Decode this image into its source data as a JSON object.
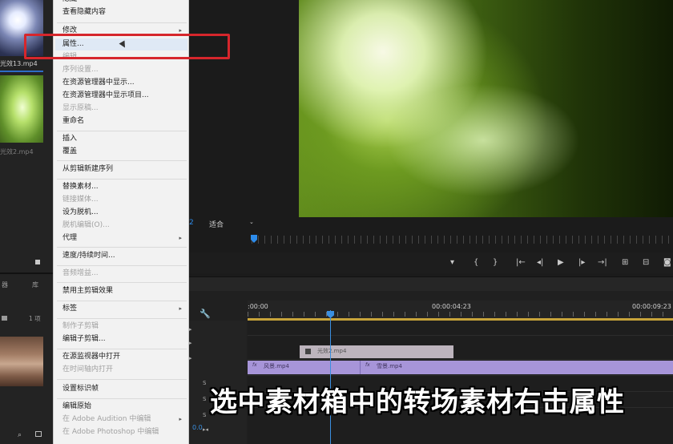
{
  "project_panel": {
    "clip_1_name": "光效13.mp4",
    "clip_2_name": "光效2.mp4",
    "tab_a": "器",
    "tab_b": "库",
    "item_count": "1 项"
  },
  "context_menu": {
    "items": [
      {
        "label": "隐藏",
        "disabled": false
      },
      {
        "label": "查看隐藏内容",
        "disabled": false
      },
      {
        "label": "修改",
        "disabled": false,
        "submenu": true
      },
      {
        "label": "属性...",
        "disabled": false,
        "highlighted": true
      },
      {
        "label": "编辑...",
        "disabled": true
      },
      {
        "label": "序列设置...",
        "disabled": true
      },
      {
        "label": "在资源管理器中显示...",
        "disabled": false
      },
      {
        "label": "在资源管理器中显示项目...",
        "disabled": false
      },
      {
        "label": "显示原稿...",
        "disabled": true
      },
      {
        "label": "重命名",
        "disabled": false
      },
      {
        "label": "插入",
        "disabled": false
      },
      {
        "label": "覆盖",
        "disabled": false
      },
      {
        "label": "从剪辑新建序列",
        "disabled": false
      },
      {
        "label": "替换素材...",
        "disabled": false
      },
      {
        "label": "链接媒体...",
        "disabled": true
      },
      {
        "label": "设为脱机...",
        "disabled": false
      },
      {
        "label": "脱机编辑(O)...",
        "disabled": true
      },
      {
        "label": "代理",
        "disabled": false,
        "submenu": true
      },
      {
        "label": "速度/持续时间...",
        "disabled": false
      },
      {
        "label": "音频增益...",
        "disabled": true
      },
      {
        "label": "禁用主剪辑效果",
        "disabled": false
      },
      {
        "label": "标签",
        "disabled": false,
        "submenu": true
      },
      {
        "label": "制作子剪辑",
        "disabled": true
      },
      {
        "label": "编辑子剪辑...",
        "disabled": false
      },
      {
        "label": "在源监视器中打开",
        "disabled": false
      },
      {
        "label": "在时间轴内打开",
        "disabled": true
      },
      {
        "label": "设置标识帧",
        "disabled": false
      },
      {
        "label": "编辑原始",
        "disabled": false
      },
      {
        "label": "在 Adobe Audition 中编辑",
        "disabled": true,
        "submenu": true
      },
      {
        "label": "在 Adobe Photoshop 中编辑",
        "disabled": true
      }
    ]
  },
  "monitor": {
    "playhead_value": "2",
    "fit_label": "适合",
    "dropdown_icon": "chevron-down-icon"
  },
  "transport": {
    "buttons": [
      "marker-icon",
      "mark-in-icon",
      "mark-out-icon",
      "go-to-in-icon",
      "step-back-icon",
      "play-icon",
      "step-forward-icon",
      "go-to-out-icon",
      "lift-icon",
      "extract-icon",
      "export-frame-icon"
    ]
  },
  "timeline": {
    "tc_start": ":00:00",
    "tc_mid": "00:00:04:23",
    "tc_end": "00:00:09:23",
    "clip_v2_name": "光效2.mp4",
    "clip_v1a_name": "风景.mp4",
    "clip_v1b_name": "雪景.mp4",
    "fx_badge": "fx",
    "track_s": "S",
    "bottom_tc": "0.0"
  },
  "subtitle": "选中素材箱中的转场素材右击属性",
  "colors": {
    "highlight_box": "#d6262c",
    "accent_blue": "#2d8ceb",
    "clip_purple": "#a795d9",
    "work_area": "#c7a33a"
  }
}
